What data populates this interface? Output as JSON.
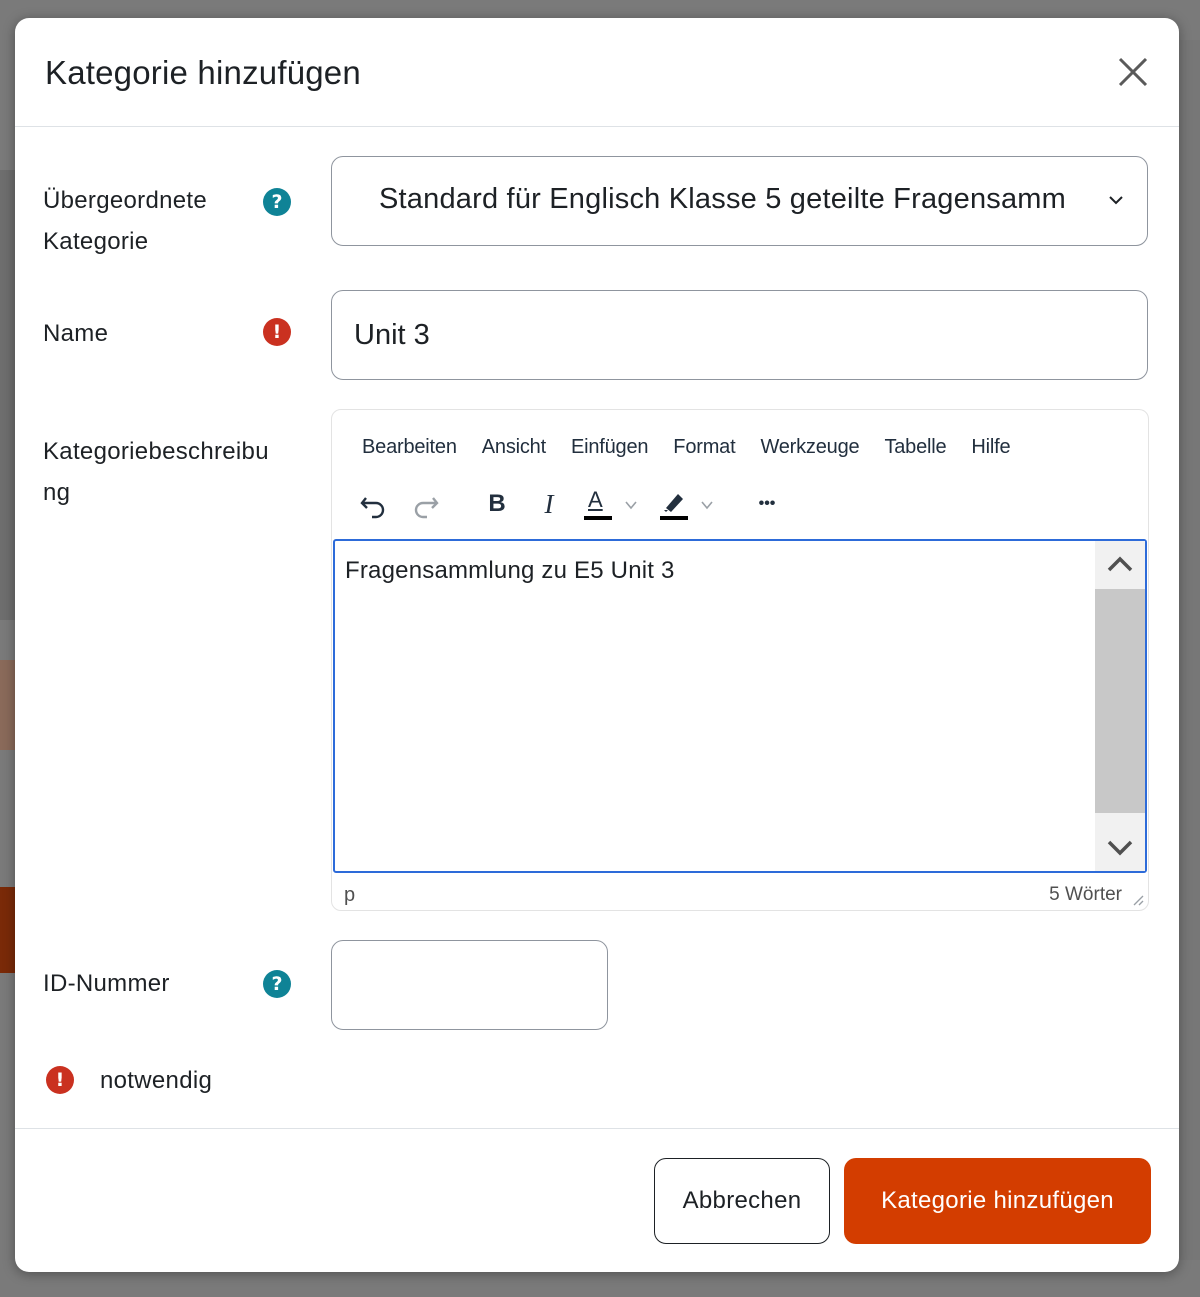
{
  "dialog": {
    "title": "Kategorie hinzufügen",
    "close_icon": "close-icon"
  },
  "fields": {
    "parent": {
      "label_line1": "Übergeordnete",
      "label_line2": "Kategorie",
      "help_icon": "question-mark-icon",
      "help_glyph": "?",
      "selected": "Standard für Englisch Klasse 5 geteilte Fragensamm"
    },
    "name": {
      "label": "Name",
      "required_icon": "exclamation-icon",
      "required_glyph": "!",
      "value": "Unit 3"
    },
    "description": {
      "label_line1": "Kategoriebeschreibu",
      "label_line2": "ng",
      "content": "Fragensammlung zu E5 Unit 3"
    },
    "idnumber": {
      "label": "ID-Nummer",
      "help_glyph": "?",
      "value": ""
    }
  },
  "editor": {
    "menu": [
      "Bearbeiten",
      "Ansicht",
      "Einfügen",
      "Format",
      "Werkzeuge",
      "Tabelle",
      "Hilfe"
    ],
    "toolbar": {
      "bold": "B",
      "italic": "I",
      "text_color": "A",
      "more": "•••"
    },
    "status_path": "p",
    "word_count": "5 Wörter"
  },
  "required_note": {
    "glyph": "!",
    "text": "notwendig"
  },
  "footer": {
    "cancel_label": "Abbrechen",
    "submit_label": "Kategorie hinzufügen"
  },
  "colors": {
    "primary": "#d33d00",
    "help": "#0f8396",
    "required": "#ca3120",
    "focus": "#2d6bd9"
  }
}
